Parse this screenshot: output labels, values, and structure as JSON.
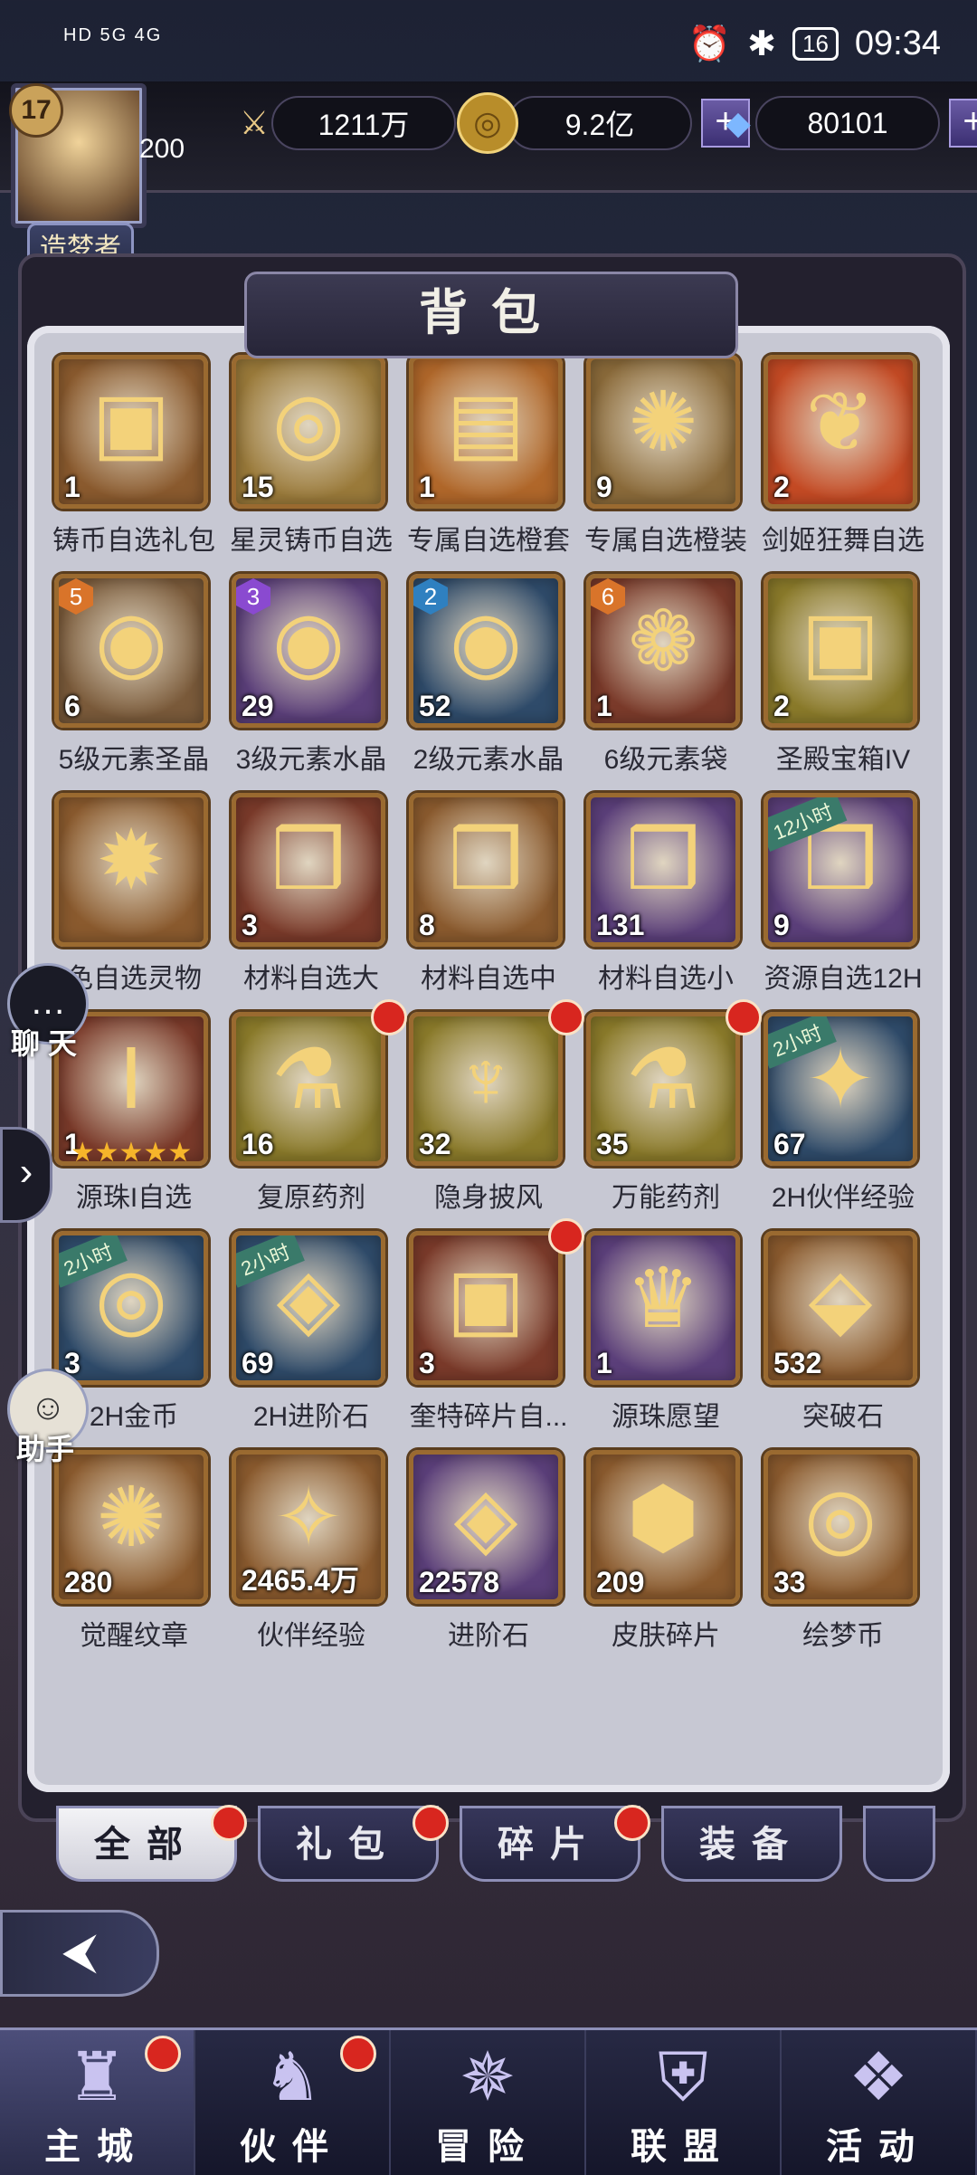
{
  "status_bar": {
    "network": "HD 5G 4G",
    "battery": "16",
    "time": "09:34"
  },
  "player": {
    "level": "17",
    "stamina": "200",
    "title": "造梦者"
  },
  "resources": [
    {
      "icon": "sword-icon",
      "value": "1211万",
      "plus": false
    },
    {
      "icon": "gold-coin-icon",
      "value": "9.2亿",
      "plus": true
    },
    {
      "icon": "diamond-icon",
      "value": "80101",
      "plus": true
    }
  ],
  "panel": {
    "title": "背包"
  },
  "items": [
    {
      "name": "铸币自选礼包",
      "count": "1",
      "glyph": "▣",
      "bg": "#8a5a2e"
    },
    {
      "name": "星灵铸币自选",
      "count": "15",
      "glyph": "◎",
      "bg": "#9a7a3a"
    },
    {
      "name": "专属自选橙套",
      "count": "1",
      "glyph": "▤",
      "bg": "#b0672a"
    },
    {
      "name": "专属自选橙装",
      "count": "9",
      "glyph": "✺",
      "bg": "#8a6a3a"
    },
    {
      "name": "剑姬狂舞自选",
      "count": "2",
      "glyph": "❦",
      "bg": "#c44a24"
    },
    {
      "name": "5级元素圣晶",
      "count": "6",
      "glyph": "◉",
      "bg": "#7a5a3a",
      "tier": "5",
      "tier_color": "#d9742a"
    },
    {
      "name": "3级元素水晶",
      "count": "29",
      "glyph": "◉",
      "bg": "#5b3f7a",
      "tier": "3",
      "tier_color": "#8a4ad0"
    },
    {
      "name": "2级元素水晶",
      "count": "52",
      "glyph": "◉",
      "bg": "#2f4b6a",
      "tier": "2",
      "tier_color": "#2f80c0"
    },
    {
      "name": "6级元素袋",
      "count": "1",
      "glyph": "❁",
      "bg": "#7a3a2a",
      "tier": "6",
      "tier_color": "#d9742a"
    },
    {
      "name": "圣殿宝箱IV",
      "count": "2",
      "glyph": "▣",
      "bg": "#8a7a2a"
    },
    {
      "name": "色自选灵物",
      "count": "",
      "glyph": "✹",
      "bg": "#8a5a2e"
    },
    {
      "name": "材料自选大",
      "count": "3",
      "glyph": "❒",
      "bg": "#7a3a2a"
    },
    {
      "name": "材料自选中",
      "count": "8",
      "glyph": "❒",
      "bg": "#8a5a2e"
    },
    {
      "name": "材料自选小",
      "count": "131",
      "glyph": "❒",
      "bg": "#5b3f7a"
    },
    {
      "name": "资源自选12H",
      "count": "9",
      "glyph": "❒",
      "bg": "#5b3f7a",
      "ribbon": "12小时"
    },
    {
      "name": "源珠I自选",
      "count": "1",
      "glyph": "Ⅰ",
      "bg": "#7a3a2a",
      "stars": "★★★★★"
    },
    {
      "name": "复原药剂",
      "count": "16",
      "glyph": "⚗",
      "bg": "#8a7a2a",
      "dot": true
    },
    {
      "name": "隐身披风",
      "count": "32",
      "glyph": "♆",
      "bg": "#8a7a2a",
      "dot": true
    },
    {
      "name": "万能药剂",
      "count": "35",
      "glyph": "⚗",
      "bg": "#8a7a2a",
      "dot": true
    },
    {
      "name": "2H伙伴经验",
      "count": "67",
      "glyph": "✦",
      "bg": "#2f4b6a",
      "ribbon": "2小时"
    },
    {
      "name": "2H金币",
      "count": "3",
      "glyph": "◎",
      "bg": "#2f4b6a",
      "ribbon": "2小时"
    },
    {
      "name": "2H进阶石",
      "count": "69",
      "glyph": "◈",
      "bg": "#2f4b6a",
      "ribbon": "2小时"
    },
    {
      "name": "奎特碎片自...",
      "count": "3",
      "glyph": "▣",
      "bg": "#7a3a2a",
      "dot": true
    },
    {
      "name": "源珠愿望",
      "count": "1",
      "glyph": "♛",
      "bg": "#5b3f7a"
    },
    {
      "name": "突破石",
      "count": "532",
      "glyph": "⬙",
      "bg": "#8a5a2e"
    },
    {
      "name": "觉醒纹章",
      "count": "280",
      "glyph": "✺",
      "bg": "#8a5a2e"
    },
    {
      "name": "伙伴经验",
      "count": "2465.4万",
      "glyph": "✧",
      "bg": "#8a5a2e"
    },
    {
      "name": "进阶石",
      "count": "22578",
      "glyph": "◈",
      "bg": "#5b3f7a"
    },
    {
      "name": "皮肤碎片",
      "count": "209",
      "glyph": "⬢",
      "bg": "#8a5a2e"
    },
    {
      "name": "绘梦币",
      "count": "33",
      "glyph": "◎",
      "bg": "#8a5a2e"
    }
  ],
  "tabs": [
    {
      "label": "全部",
      "active": true,
      "dot": true
    },
    {
      "label": "礼包",
      "active": false,
      "dot": true
    },
    {
      "label": "碎片",
      "active": false,
      "dot": true
    },
    {
      "label": "装备",
      "active": false,
      "dot": false
    }
  ],
  "side": {
    "chat_label": "聊 天",
    "assistant_label": "助手"
  },
  "nav": [
    {
      "label": "主城",
      "icon": "castle-icon",
      "glyph": "♜",
      "active": true,
      "dot": true
    },
    {
      "label": "伙伴",
      "icon": "wizard-hat-icon",
      "glyph": "♞",
      "active": false,
      "dot": true
    },
    {
      "label": "冒险",
      "icon": "compass-icon",
      "glyph": "✵",
      "active": false,
      "dot": false
    },
    {
      "label": "联盟",
      "icon": "shield-icon",
      "glyph": "⛨",
      "active": false,
      "dot": false
    },
    {
      "label": "活动",
      "icon": "cards-icon",
      "glyph": "❖",
      "active": false,
      "dot": false
    }
  ]
}
